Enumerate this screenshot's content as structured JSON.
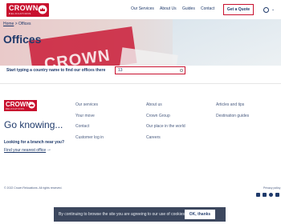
{
  "header": {
    "logo_text": "CROWN",
    "logo_sub": "RELOCATIONS",
    "nav": [
      {
        "label": "Our Services"
      },
      {
        "label": "About Us"
      },
      {
        "label": "Guides"
      },
      {
        "label": "Contact"
      }
    ],
    "cta": "Get a Quote",
    "lang_chevron": "⌄"
  },
  "hero": {
    "breadcrumb_home": "Home",
    "breadcrumb_sep": ">",
    "breadcrumb_current": "Offices",
    "title": "Offices",
    "truck_text": "CROWN"
  },
  "search": {
    "label": "Start typing a country name to find our offices there",
    "value": "13"
  },
  "footer": {
    "logo_text": "CROWN",
    "logo_sub": "RELOCATIONS",
    "tagline": "Go knowing...",
    "branch_question": "Looking for a branch near you?",
    "find_link": "Find your nearest office",
    "arrow": "→",
    "col1": [
      "Our services",
      "Your move",
      "Contact",
      "Customer log in"
    ],
    "col2": [
      "About us",
      "Crown Group",
      "Our place in the world",
      "Careers"
    ],
    "col3": [
      "Articles and tips",
      "Destination guides"
    ],
    "copyright": "© 2022 Crown Relocations. All rights reserved.",
    "privacy": "Privacy policy",
    "social": [
      "twitter-icon",
      "linkedin-icon",
      "facebook-icon",
      "youtube-icon"
    ]
  },
  "cookie": {
    "text": "By continuing to browse the site you are agreeing to our use of cookies.",
    "button": "OK, thanks"
  },
  "colors": {
    "brand_red": "#c8102e",
    "brand_navy": "#1f3a6b"
  }
}
